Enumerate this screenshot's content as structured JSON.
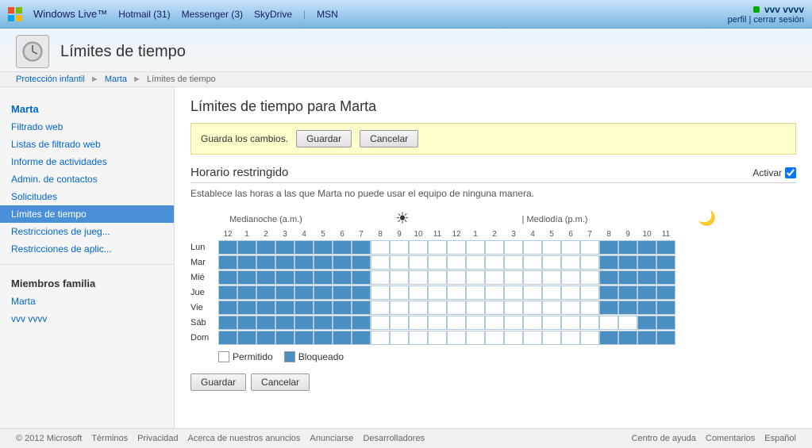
{
  "topbar": {
    "brand": "Windows Live™",
    "hotmail_label": "Hotmail",
    "hotmail_badge": "31",
    "messenger_label": "Messenger",
    "messenger_badge": "3",
    "skydrive_label": "SkyDrive",
    "msn_label": "MSN",
    "separator": "|",
    "user_name": "vvv vvvv",
    "user_links_perfil": "perfil",
    "user_links_cerrar": "cerrar sesión"
  },
  "page_header": {
    "icon_symbol": "🔒",
    "title": "Límites de tiempo"
  },
  "breadcrumb": {
    "item1": "Protección infantil",
    "item2": "Marta",
    "item3": "Límites de tiempo"
  },
  "sidebar": {
    "current_user": "Marta",
    "nav_items": [
      {
        "label": "Filtrado web",
        "id": "filtrado-web",
        "active": false
      },
      {
        "label": "Listas de filtrado web",
        "id": "listas-filtrado",
        "active": false
      },
      {
        "label": "Informe de actividades",
        "id": "informe-actividades",
        "active": false
      },
      {
        "label": "Admin. de contactos",
        "id": "admin-contactos",
        "active": false
      },
      {
        "label": "Solicitudes",
        "id": "solicitudes",
        "active": false
      },
      {
        "label": "Límites de tiempo",
        "id": "limites-tiempo",
        "active": true
      },
      {
        "label": "Restricciones de jueg...",
        "id": "restricciones-juego",
        "active": false
      },
      {
        "label": "Restricciones de aplic...",
        "id": "restricciones-aplic",
        "active": false
      }
    ],
    "family_title": "Miembros familia",
    "family_members": [
      {
        "label": "Marta",
        "id": "member-marta"
      },
      {
        "label": "vvv vvvv",
        "id": "member-vvv"
      }
    ]
  },
  "content": {
    "title": "Límites de tiempo para Marta",
    "save_banner_text": "Guarda los cambios.",
    "btn_guardar": "Guardar",
    "btn_cancelar": "Cancelar",
    "section_title": "Horario restringido",
    "activar_label": "Activar",
    "section_desc": "Establece las horas a las que Marta no puede usar el equipo de ninguna manera.",
    "midnight_label": "Medianoche (a.m.)",
    "noon_label": "| Mediodía (p.m.)",
    "hours": [
      "12",
      "1",
      "2",
      "3",
      "4",
      "5",
      "6",
      "7",
      "8",
      "9",
      "10",
      "11",
      "12",
      "1",
      "2",
      "3",
      "4",
      "5",
      "6",
      "7",
      "8",
      "9",
      "10",
      "11"
    ],
    "days": [
      "Lun",
      "Mar",
      "Mié",
      "Jue",
      "Vie",
      "Sáb",
      "Dom"
    ],
    "grid": [
      [
        1,
        1,
        1,
        1,
        1,
        1,
        1,
        1,
        0,
        0,
        0,
        0,
        0,
        0,
        0,
        0,
        0,
        0,
        0,
        0,
        1,
        1,
        1,
        1
      ],
      [
        1,
        1,
        1,
        1,
        1,
        1,
        1,
        1,
        0,
        0,
        0,
        0,
        0,
        0,
        0,
        0,
        0,
        0,
        0,
        0,
        1,
        1,
        1,
        1
      ],
      [
        1,
        1,
        1,
        1,
        1,
        1,
        1,
        1,
        0,
        0,
        0,
        0,
        0,
        0,
        0,
        0,
        0,
        0,
        0,
        0,
        1,
        1,
        1,
        1
      ],
      [
        1,
        1,
        1,
        1,
        1,
        1,
        1,
        1,
        0,
        0,
        0,
        0,
        0,
        0,
        0,
        0,
        0,
        0,
        0,
        0,
        1,
        1,
        1,
        1
      ],
      [
        1,
        1,
        1,
        1,
        1,
        1,
        1,
        1,
        0,
        0,
        0,
        0,
        0,
        0,
        0,
        0,
        0,
        0,
        0,
        0,
        1,
        1,
        1,
        1
      ],
      [
        1,
        1,
        1,
        1,
        1,
        1,
        1,
        1,
        0,
        0,
        0,
        0,
        0,
        0,
        0,
        0,
        0,
        0,
        0,
        0,
        0,
        0,
        1,
        1
      ],
      [
        1,
        1,
        1,
        1,
        1,
        1,
        1,
        1,
        0,
        0,
        0,
        0,
        0,
        0,
        0,
        0,
        0,
        0,
        0,
        0,
        1,
        1,
        1,
        1
      ]
    ],
    "legend_free": "Permitido",
    "legend_blocked": "Bloqueado",
    "btn_guardar2": "Guardar",
    "btn_cancelar2": "Cancelar"
  },
  "footer": {
    "copyright": "© 2012 Microsoft",
    "links_left": [
      "Términos",
      "Privacidad",
      "Acerca de nuestros anuncios",
      "Anunciarse",
      "Desarrolladores"
    ],
    "links_right": [
      "Centro de ayuda",
      "Comentarios",
      "Español"
    ]
  }
}
